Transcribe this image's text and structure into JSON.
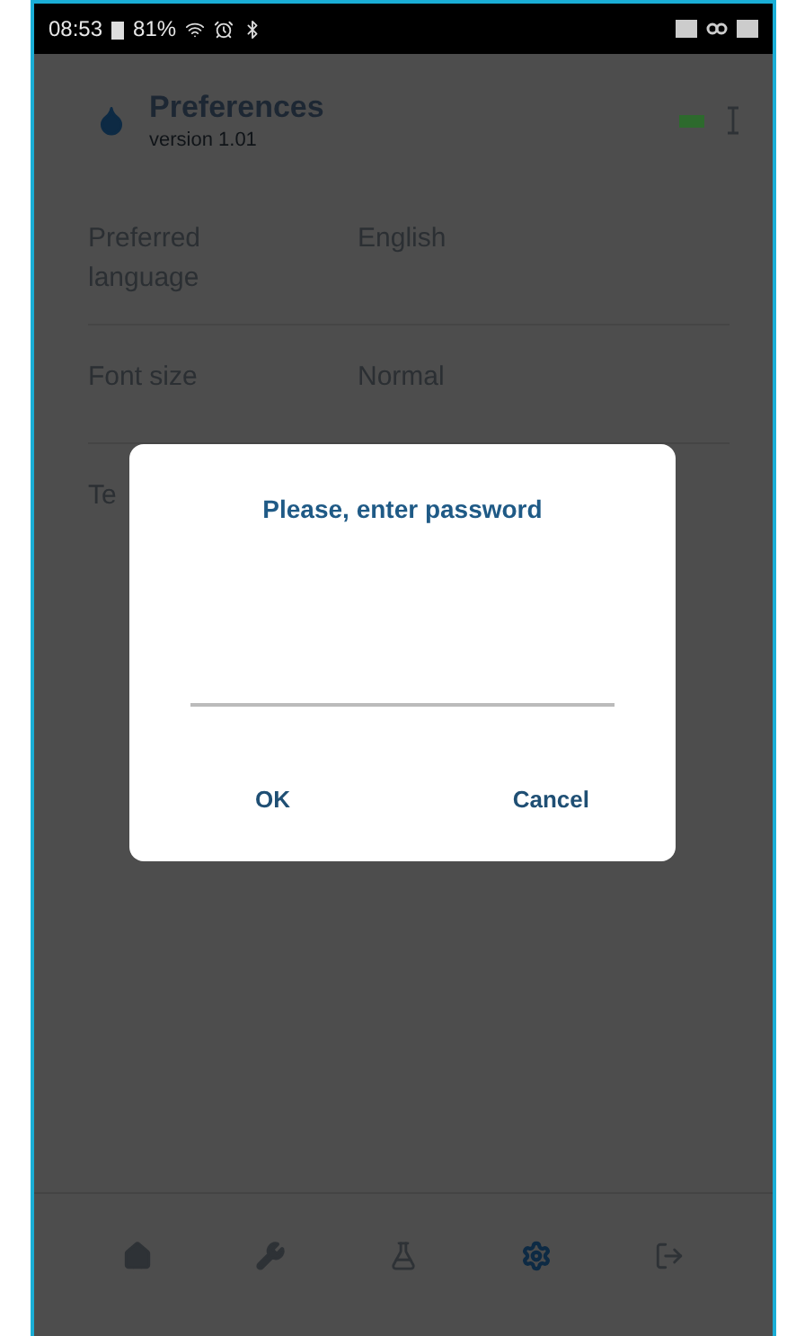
{
  "status_bar": {
    "time": "08:53",
    "battery": "81%"
  },
  "header": {
    "title": "Preferences",
    "subtitle": "version 1.01"
  },
  "settings": [
    {
      "label": "Preferred language",
      "value": "English"
    },
    {
      "label": "Font size",
      "value": "Normal"
    },
    {
      "label": "Te"
    }
  ],
  "dialog": {
    "title": "Please, enter password",
    "buttons": [
      "OK",
      "Cancel"
    ]
  },
  "nav": [
    {
      "kind": "home",
      "selected": false
    },
    {
      "kind": "tools",
      "selected": false
    },
    {
      "kind": "lab",
      "selected": false
    },
    {
      "kind": "settings",
      "selected": true
    },
    {
      "kind": "logout",
      "selected": false
    }
  ]
}
